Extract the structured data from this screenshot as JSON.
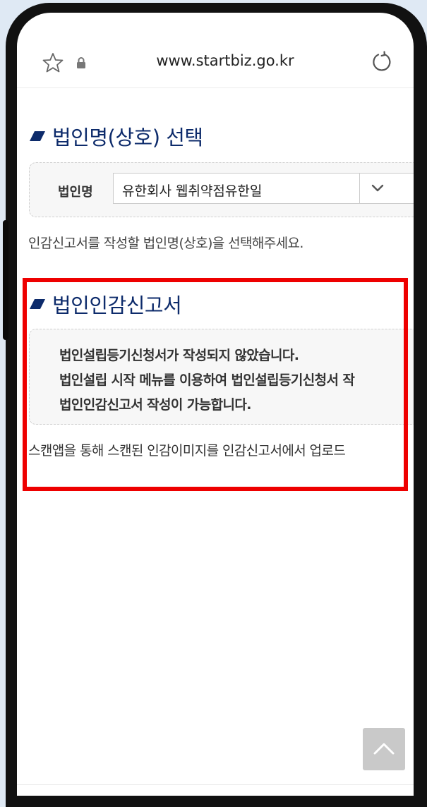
{
  "browser": {
    "url": "www.startbiz.go.kr"
  },
  "section1": {
    "title": "법인명(상호) 선택",
    "select_label": "법인명",
    "select_value": "유한회사 웹취약점유한일",
    "help_text": "인감신고서를 작성할 법인명(상호)을 선택해주세요."
  },
  "section2": {
    "title": "법인인감신고서",
    "notice_lines": [
      "법인설립등기신청서가 작성되지 않았습니다.",
      "법인설립 시작 메뉴를 이용하여 법인설립등기신청서 작",
      "법인인감신고서 작성이 가능합니다."
    ],
    "scan_text": "스캔앱을 통해 스캔된 인감이미지를 인감신고서에서 업로드"
  },
  "colors": {
    "title": "#0d2b6b",
    "highlight": "#ee0000",
    "page_bg": "#dfe9f4"
  },
  "icons": [
    "star-icon",
    "lock-icon",
    "reload-icon",
    "chevron-down-icon",
    "scroll-top-icon",
    "title-mark-icon"
  ]
}
